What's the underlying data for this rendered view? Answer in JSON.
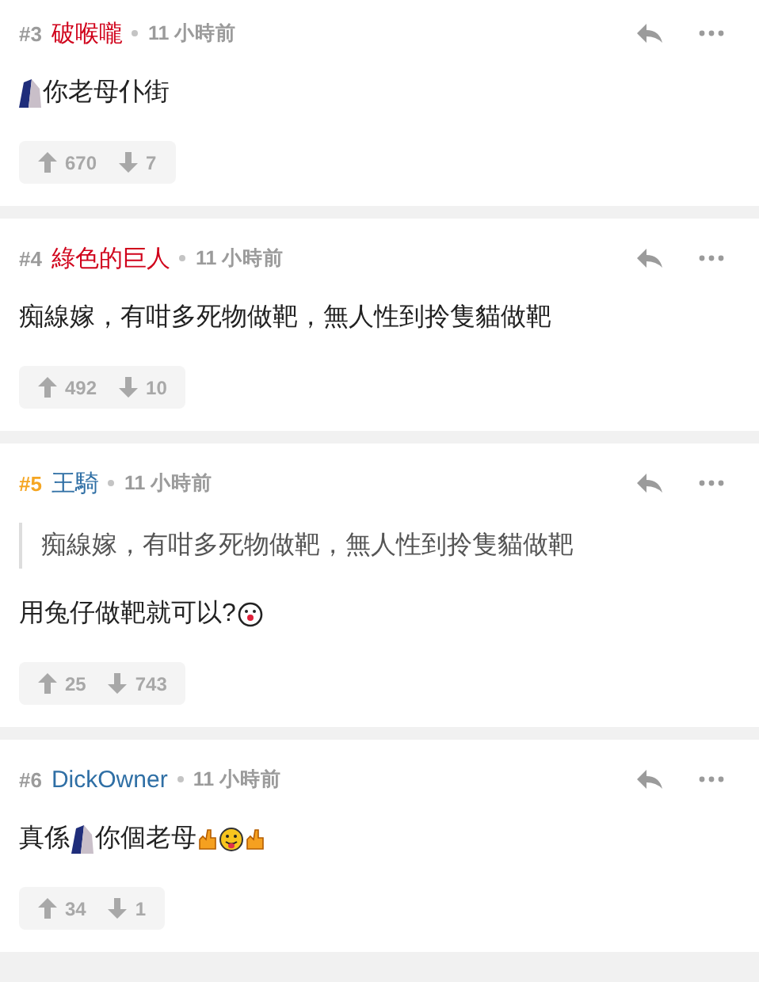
{
  "comments": [
    {
      "number": {
        "text": "#3",
        "color": "#9b9b9b"
      },
      "author": {
        "name": "破喉嚨",
        "color": "#d0021b"
      },
      "time": "11 小時前",
      "body": [
        {
          "kind": "image"
        },
        {
          "kind": "text",
          "text": "你老母仆街"
        }
      ],
      "upvotes": "670",
      "downvotes": "7"
    },
    {
      "number": {
        "text": "#4",
        "color": "#9b9b9b"
      },
      "author": {
        "name": "綠色的巨人",
        "color": "#d0021b"
      },
      "time": "11 小時前",
      "body": [
        {
          "kind": "text",
          "text": "痴線嫁，有咁多死物做靶，無人性到拎隻貓做靶"
        }
      ],
      "upvotes": "492",
      "downvotes": "10"
    },
    {
      "number": {
        "text": "#5",
        "color": "#f5a623"
      },
      "author": {
        "name": "王騎",
        "color": "#2f6fa5"
      },
      "time": "11 小時前",
      "quote": "痴線嫁，有咁多死物做靶，無人性到拎隻貓做靶",
      "body": [
        {
          "kind": "text",
          "text": "用兔仔做靶就可以?"
        },
        {
          "kind": "clown"
        }
      ],
      "upvotes": "25",
      "downvotes": "743"
    },
    {
      "number": {
        "text": "#6",
        "color": "#9b9b9b"
      },
      "author": {
        "name": "DickOwner",
        "color": "#2f6fa5"
      },
      "time": "11 小時前",
      "body": [
        {
          "kind": "text",
          "text": "真係"
        },
        {
          "kind": "image"
        },
        {
          "kind": "text",
          "text": "你個老母"
        },
        {
          "kind": "hand"
        },
        {
          "kind": "tongue"
        },
        {
          "kind": "hand"
        }
      ],
      "upvotes": "34",
      "downvotes": "1"
    }
  ]
}
